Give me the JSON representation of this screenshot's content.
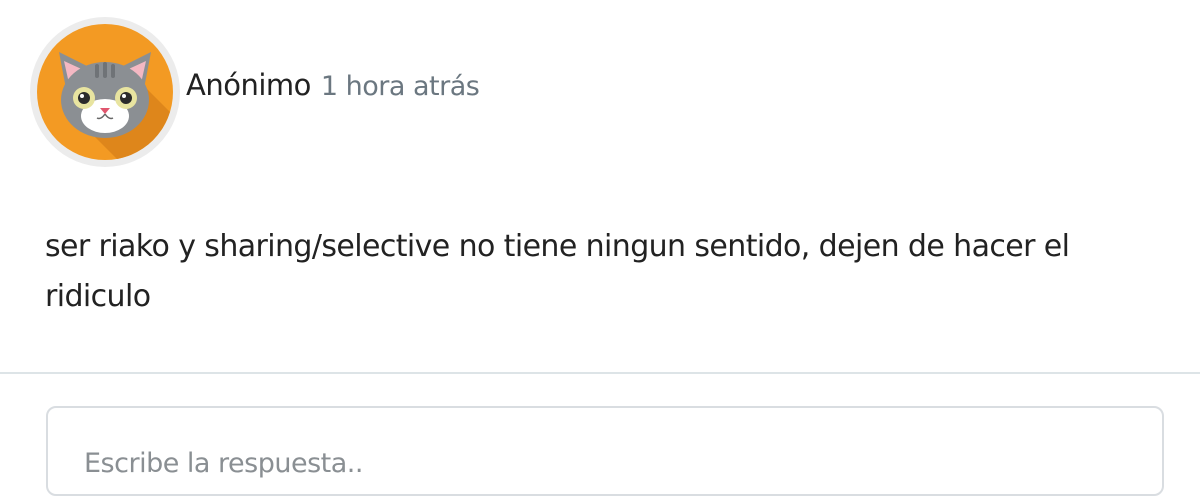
{
  "post": {
    "author": "Anónimo",
    "time": "1 hora atrás",
    "avatar_icon": "cat-avatar-icon",
    "message": "ser riako y sharing/selective no tiene ningun sentido, dejen de hacer el ridiculo"
  },
  "reply": {
    "placeholder": "Escribe la respuesta.."
  },
  "colors": {
    "avatar_bg": "#f39a23",
    "avatar_ring": "#ececec",
    "cat_fur": "#8b8f93",
    "time_text": "#6b7780",
    "divider": "#dde4e7"
  }
}
